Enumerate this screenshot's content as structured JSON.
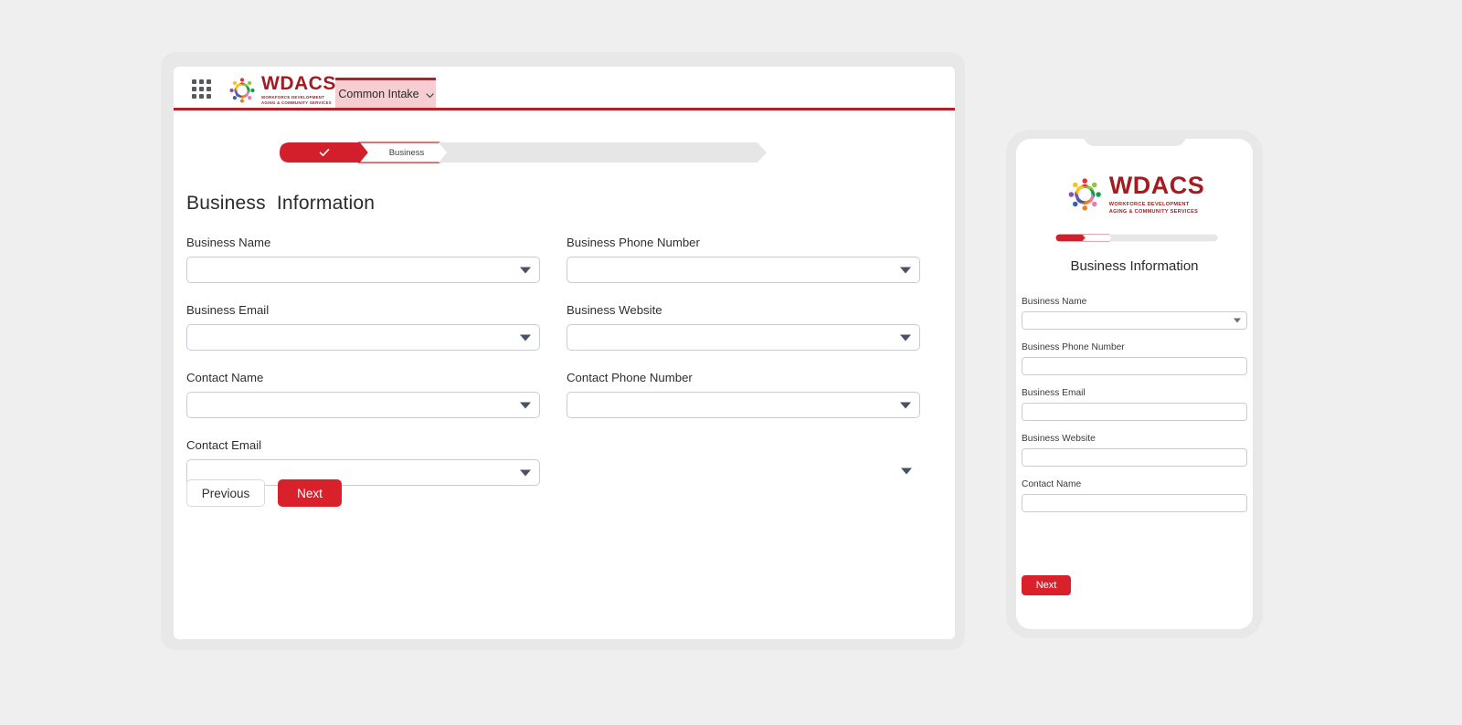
{
  "app": {
    "brand_word": "WDACS",
    "brand_tagline_line1": "WORKFORCE DEVELOPMENT",
    "brand_tagline_line2": "AGING & COMMUNITY SERVICES",
    "brand_color": "#a31c22",
    "accent_red": "#d9212c",
    "tab_bar_red": "#b32027",
    "tab_background": "#f6cdd0",
    "page_background": "#efefef",
    "frame_gray": "#e8e8e8"
  },
  "topbar": {
    "app_launcher_icon": "app-grid-icon",
    "tab_label": "Common Intake",
    "tab_chevron_icon": "chevron-down-icon"
  },
  "stepper": {
    "steps": [
      {
        "label": "",
        "state": "completed",
        "icon": "check-icon"
      },
      {
        "label": "Business",
        "state": "current"
      },
      {
        "label": "",
        "state": "upcoming"
      },
      {
        "label": "",
        "state": "upcoming"
      },
      {
        "label": "",
        "state": "upcoming"
      },
      {
        "label": "",
        "state": "upcoming"
      }
    ],
    "completed_count": 1,
    "total_count": 6,
    "current_index": 1
  },
  "main": {
    "page_title": "Business  Information",
    "fields_left": [
      {
        "label": "Business Name",
        "value": "",
        "placeholder": "",
        "control": "combobox"
      },
      {
        "label": "Business Email",
        "value": "",
        "placeholder": "",
        "control": "combobox"
      },
      {
        "label": "Contact Name",
        "value": "",
        "placeholder": "",
        "control": "combobox"
      },
      {
        "label": "Contact Email",
        "value": "",
        "placeholder": "",
        "control": "combobox"
      }
    ],
    "fields_right": [
      {
        "label": "Business Phone Number",
        "value": "",
        "placeholder": "",
        "control": "combobox"
      },
      {
        "label": "Business Website",
        "value": "",
        "placeholder": "",
        "control": "combobox"
      },
      {
        "label": "Contact Phone Number",
        "value": "",
        "placeholder": "",
        "control": "combobox"
      },
      {
        "label": "",
        "value": "",
        "placeholder": "",
        "control": "bare-caret"
      }
    ],
    "buttons": {
      "previous_label": "Previous",
      "next_label": "Next"
    }
  },
  "mobile": {
    "page_title": "Business Information",
    "stepper": {
      "completed_count": 1,
      "total_count": 6,
      "current_index": 1
    },
    "fields": [
      {
        "label": "Business Name",
        "value": "",
        "placeholder": "",
        "control": "combobox"
      },
      {
        "label": "Business Phone Number",
        "value": "",
        "placeholder": "",
        "control": "text"
      },
      {
        "label": "Business Email",
        "value": "",
        "placeholder": "",
        "control": "text"
      },
      {
        "label": "Business Website",
        "value": "",
        "placeholder": "",
        "control": "text"
      },
      {
        "label": "Contact Name",
        "value": "",
        "placeholder": "",
        "control": "text"
      }
    ],
    "buttons": {
      "next_label": "Next"
    }
  }
}
